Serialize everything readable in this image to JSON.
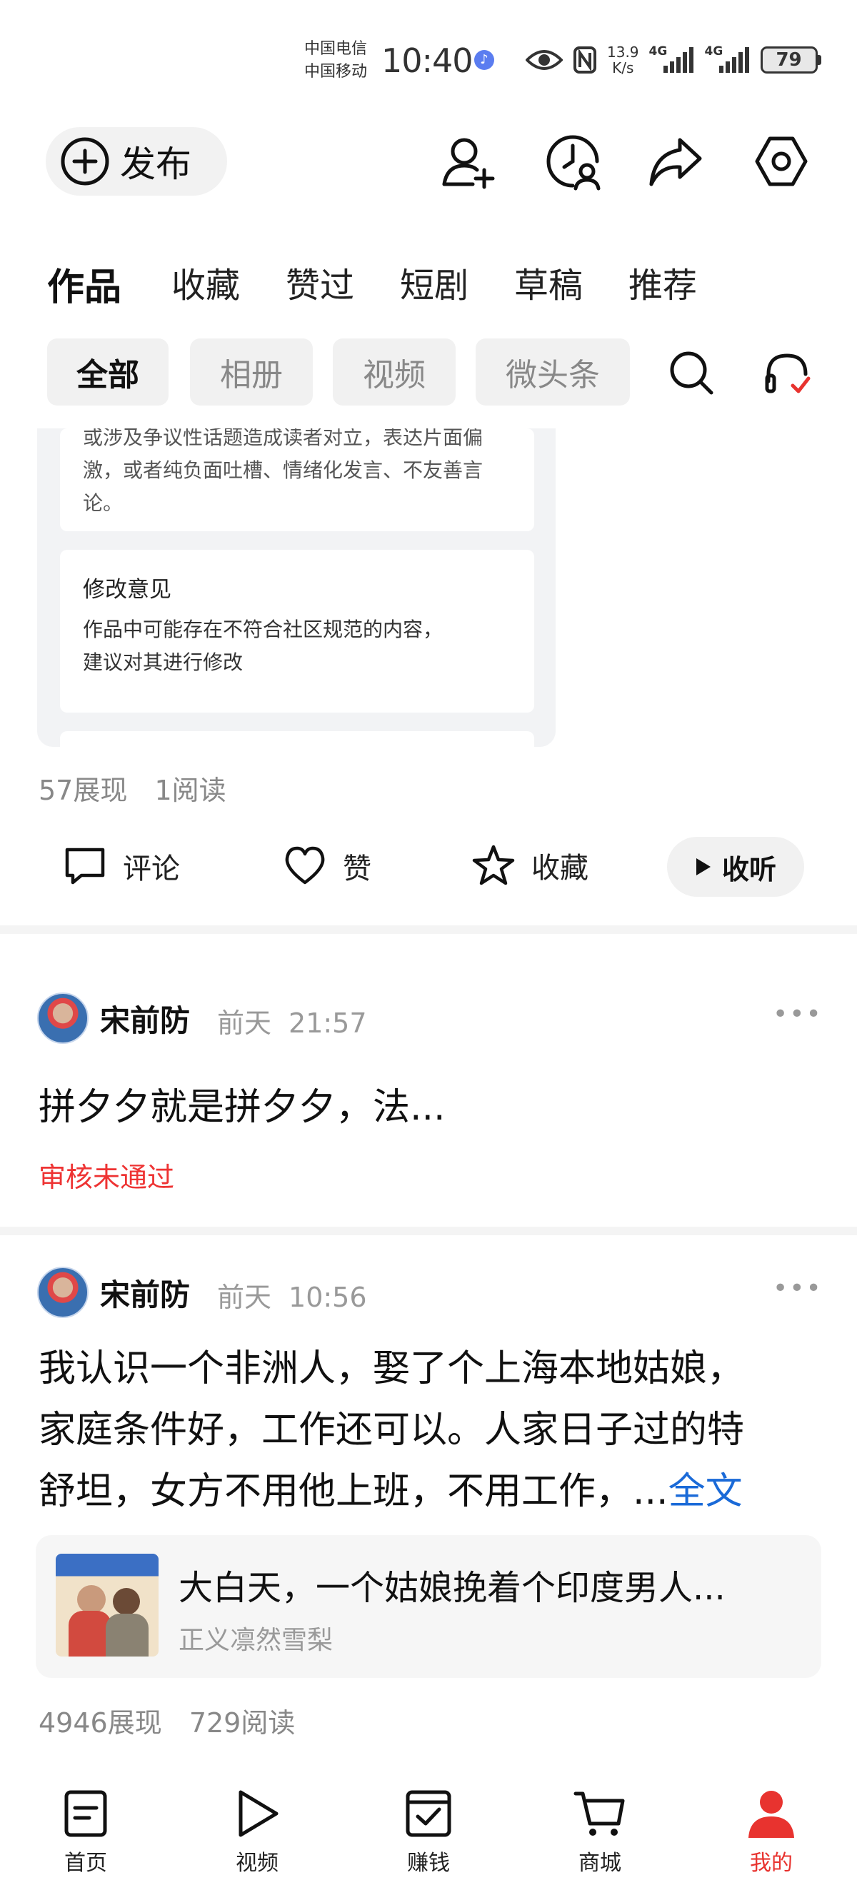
{
  "status_bar": {
    "carrier_1": "中国电信",
    "carrier_2": "中国移动",
    "time": "10:40",
    "net_speed_value": "13.9",
    "net_speed_unit": "K/s",
    "signal_1": "4G",
    "signal_2": "4G",
    "battery": "79"
  },
  "header": {
    "publish_label": "发布",
    "icons": [
      "add-user-icon",
      "history-icon",
      "share-icon",
      "settings-icon"
    ]
  },
  "tabs": [
    {
      "label": "作品",
      "active": true
    },
    {
      "label": "收藏"
    },
    {
      "label": "赞过"
    },
    {
      "label": "短剧"
    },
    {
      "label": "草稿"
    },
    {
      "label": "推荐"
    }
  ],
  "filters": [
    {
      "label": "全部",
      "active": true
    },
    {
      "label": "相册"
    },
    {
      "label": "视频"
    },
    {
      "label": "微头条"
    }
  ],
  "post1": {
    "embedded_text_top_1": "或涉及争议性话题造成读者对立，表达片面偏",
    "embedded_text_top_2": "激，或者纯负面吐槽、情绪化发言、不友善言",
    "embedded_text_top_3": "论。",
    "embedded_section_title": "修改意见",
    "embedded_section_body_1": "作品中可能存在不符合社区规范的内容，",
    "embedded_section_body_2": "建议对其进行修改",
    "impressions": "57展现",
    "reads": "1阅读",
    "actions": {
      "comment": "评论",
      "like": "赞",
      "favorite": "收藏",
      "listen": "收听"
    }
  },
  "post2": {
    "author": "宋前防",
    "day": "前天",
    "time": "21:57",
    "text": "拼夕夕就是拼夕夕，法...",
    "status": "审核未通过"
  },
  "post3": {
    "author": "宋前防",
    "day": "前天",
    "time": "10:56",
    "text_line_1": "我认识一个非洲人，娶了个上海本地姑娘，",
    "text_line_2": "家庭条件好，工作还可以。人家日子过的特",
    "text_line_3": "舒坦，女方不用他上班，不用工作，...",
    "read_more": "全文",
    "quote_title": "大白天，一个姑娘挽着个印度男人...",
    "quote_author": "正义凛然雪梨",
    "impressions": "4946展现",
    "reads": "729阅读"
  },
  "bottom_nav": [
    {
      "label": "首页",
      "icon": "home-icon"
    },
    {
      "label": "视频",
      "icon": "video-icon"
    },
    {
      "label": "赚钱",
      "icon": "earn-icon"
    },
    {
      "label": "商城",
      "icon": "cart-icon"
    },
    {
      "label": "我的",
      "icon": "profile-icon",
      "active": true
    }
  ],
  "colors": {
    "accent_red": "#e8332f",
    "link_blue": "#1a6ad8",
    "muted_text": "#999999"
  }
}
